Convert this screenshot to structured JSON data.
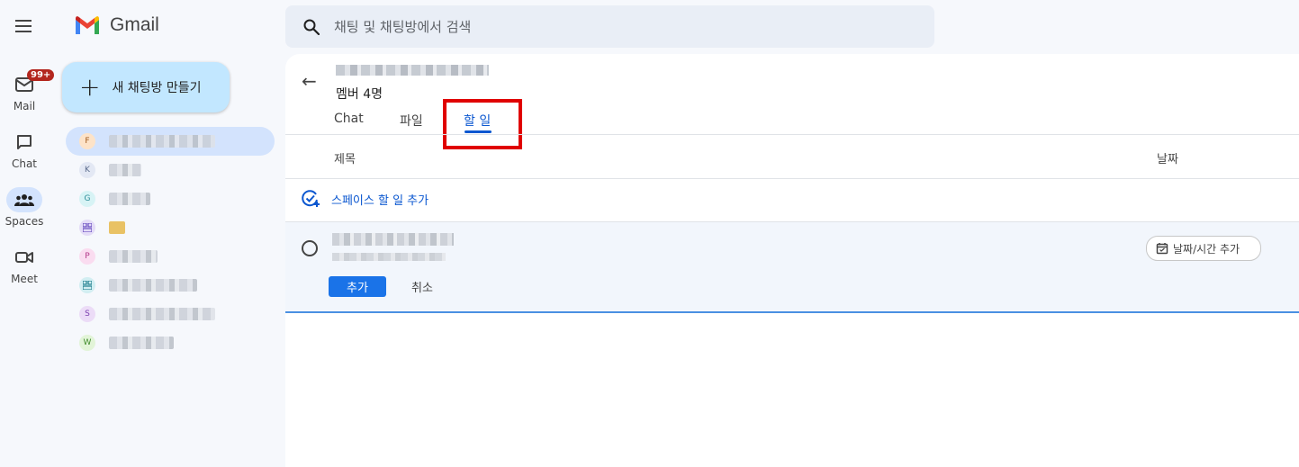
{
  "rail": {
    "items": [
      {
        "label": "Mail",
        "badge": "99+"
      },
      {
        "label": "Chat"
      },
      {
        "label": "Spaces"
      },
      {
        "label": "Meet"
      }
    ]
  },
  "app": {
    "name": "Gmail"
  },
  "sidebar": {
    "new_chat_label": "새 채팅방 만들기",
    "spaces": [
      {
        "initial": "F",
        "color": "#fde3c8"
      },
      {
        "initial": "K",
        "color": "#e3e8f4"
      },
      {
        "initial": "G",
        "color": "#d7f3f5"
      },
      {
        "initial": "",
        "color": "#e4dcf7"
      },
      {
        "initial": "P",
        "color": "#fadcf0"
      },
      {
        "initial": "",
        "color": "#d2eef2"
      },
      {
        "initial": "S",
        "color": "#ecdcf7"
      },
      {
        "initial": "W",
        "color": "#e2f4d8"
      }
    ]
  },
  "search": {
    "placeholder": "채팅 및 채팅방에서 검색"
  },
  "space": {
    "members": "멤버 4명",
    "tabs": [
      "Chat",
      "파일",
      "할 일"
    ],
    "active_tab": "할 일"
  },
  "tasks": {
    "col_title": "제목",
    "col_date": "날짜",
    "add_task_label": "스페이스 할 일 추가",
    "date_chip_label": "날짜/시간 추가",
    "add_button": "추가",
    "cancel_button": "취소"
  },
  "colors": {
    "accent": "#0b57d0",
    "highlight_box": "#e00000",
    "badge": "#b3261e"
  }
}
